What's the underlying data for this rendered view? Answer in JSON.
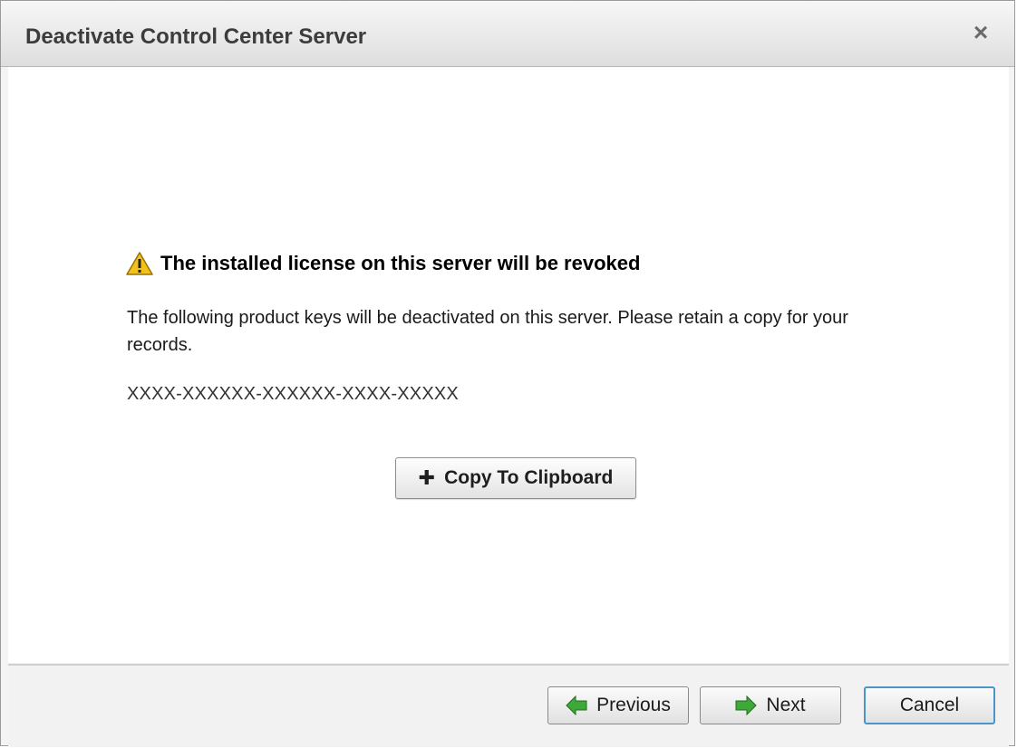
{
  "window": {
    "title": "Deactivate Control Center Server",
    "close_glyph": "×"
  },
  "warning": {
    "icon": "warning-icon",
    "heading": "The installed license on this server will be revoked"
  },
  "message": "The following product keys will be deactivated on this server.  Please retain a copy for your records.",
  "product_key": "XXXX-XXXXXX-XXXXXX-XXXX-XXXXX",
  "copy_button": {
    "icon": "plus-icon",
    "glyph": "✚",
    "label": "Copy To Clipboard"
  },
  "footer": {
    "previous": {
      "label": "Previous",
      "icon": "arrow-left-icon"
    },
    "next": {
      "label": "Next",
      "icon": "arrow-right-icon"
    },
    "cancel": {
      "label": "Cancel"
    }
  },
  "colors": {
    "arrow_green": "#3fa83a",
    "cancel_focus": "#4b95c9",
    "warning_yellow": "#f2c21b"
  }
}
